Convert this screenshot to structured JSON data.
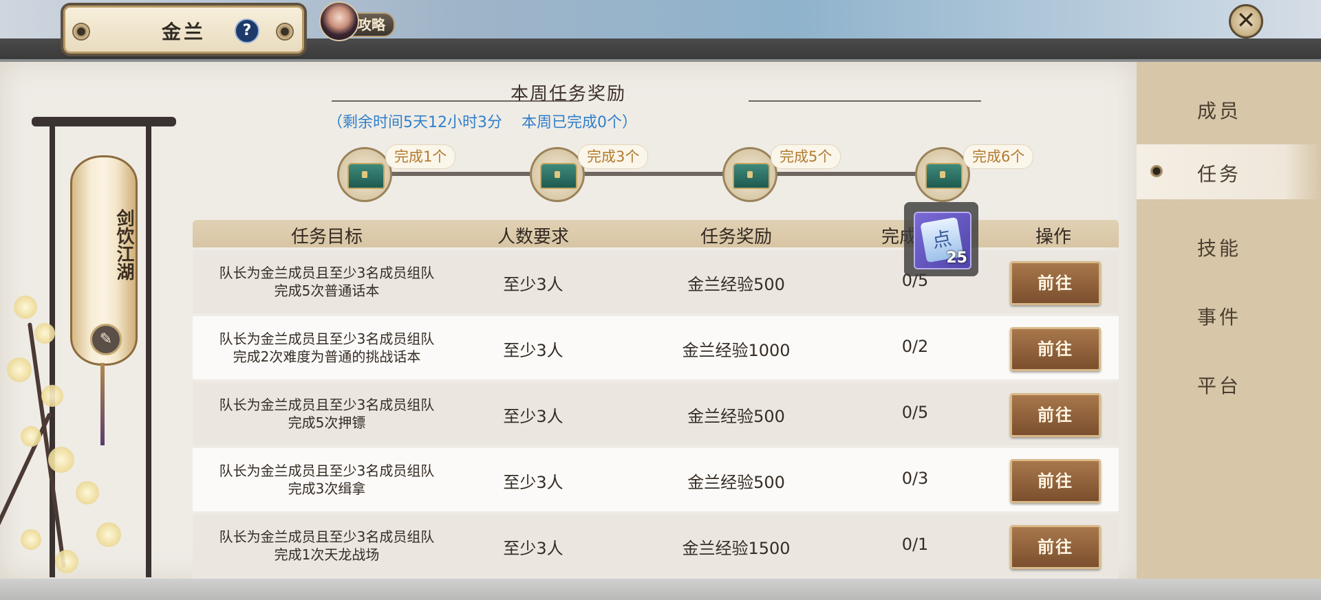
{
  "header": {
    "title": "金兰",
    "help_glyph": "?",
    "guide_label": "攻略",
    "close_glyph": "✕"
  },
  "side_tabs": [
    {
      "label": "成员",
      "active": false
    },
    {
      "label": "任务",
      "active": true
    },
    {
      "label": "技能",
      "active": false
    },
    {
      "label": "事件",
      "active": false
    },
    {
      "label": "平台",
      "active": false
    }
  ],
  "lantern": {
    "text": "剑饮江湖"
  },
  "weekly": {
    "title": "本周任务奖励",
    "subtitle": "（剩余时间5天12小时3分    本周已完成0个）",
    "milestones": [
      {
        "label": "完成1个"
      },
      {
        "label": "完成3个"
      },
      {
        "label": "完成5个"
      },
      {
        "label": "完成6个"
      }
    ]
  },
  "tooltip": {
    "item_glyph": "点",
    "count": "25"
  },
  "table": {
    "headers": {
      "goal": "任务目标",
      "req": "人数要求",
      "reward": "任务奖励",
      "progress": "完成进",
      "action": "操作"
    },
    "rows": [
      {
        "goal": "队长为金兰成员且至少3名成员组队\n完成5次普通话本",
        "req": "至少3人",
        "reward": "金兰经验500",
        "progress": "0/5",
        "action": "前往"
      },
      {
        "goal": "队长为金兰成员且至少3名成员组队\n完成2次难度为普通的挑战话本",
        "req": "至少3人",
        "reward": "金兰经验1000",
        "progress": "0/2",
        "action": "前往"
      },
      {
        "goal": "队长为金兰成员且至少3名成员组队\n完成5次押镖",
        "req": "至少3人",
        "reward": "金兰经验500",
        "progress": "0/5",
        "action": "前往"
      },
      {
        "goal": "队长为金兰成员且至少3名成员组队\n完成3次缉拿",
        "req": "至少3人",
        "reward": "金兰经验500",
        "progress": "0/3",
        "action": "前往"
      },
      {
        "goal": "队长为金兰成员且至少3名成员组队\n完成1次天龙战场",
        "req": "至少3人",
        "reward": "金兰经验1500",
        "progress": "0/1",
        "action": "前往"
      }
    ]
  },
  "colors": {
    "subtitle_blue": "#2f7fca",
    "milestone_gold": "#b27a2f",
    "button_brown": "#8a5a34"
  },
  "icons": [
    "help-icon",
    "close-icon",
    "chest-icon",
    "brush-icon",
    "scroll-item-icon",
    "tab-bullet-icon"
  ]
}
